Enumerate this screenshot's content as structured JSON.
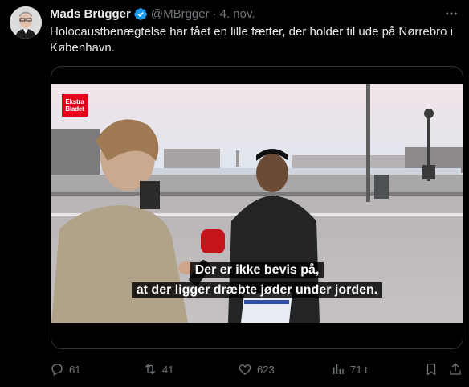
{
  "author": {
    "display_name": "Mads Brügger",
    "handle": "@MBrgger",
    "separator": "·",
    "date": "4. nov."
  },
  "tweet_text": "Holocaustbenægtelse har fået en lille fætter, der holder til ude på Nørrebro i København.",
  "video": {
    "logo_line1": "Ekstra",
    "logo_line2": "Bladet",
    "subtitle_line1": "Der er ikke bevis på,",
    "subtitle_line2": "at der ligger dræbte jøder under jorden.",
    "mic_label": "Ekstra"
  },
  "actions": {
    "replies": "61",
    "reposts": "41",
    "likes": "623",
    "views": "71 t"
  },
  "icons": {
    "verified": "verified-badge-icon",
    "more": "more-icon",
    "reply": "reply-icon",
    "repost": "repost-icon",
    "like": "like-icon",
    "views": "views-icon",
    "bookmark": "bookmark-icon",
    "share": "share-icon"
  },
  "colors": {
    "background": "#000000",
    "text": "#e7e9ea",
    "muted": "#71767b",
    "verified": "#1d9bf0",
    "brand_red": "#e3001b"
  }
}
